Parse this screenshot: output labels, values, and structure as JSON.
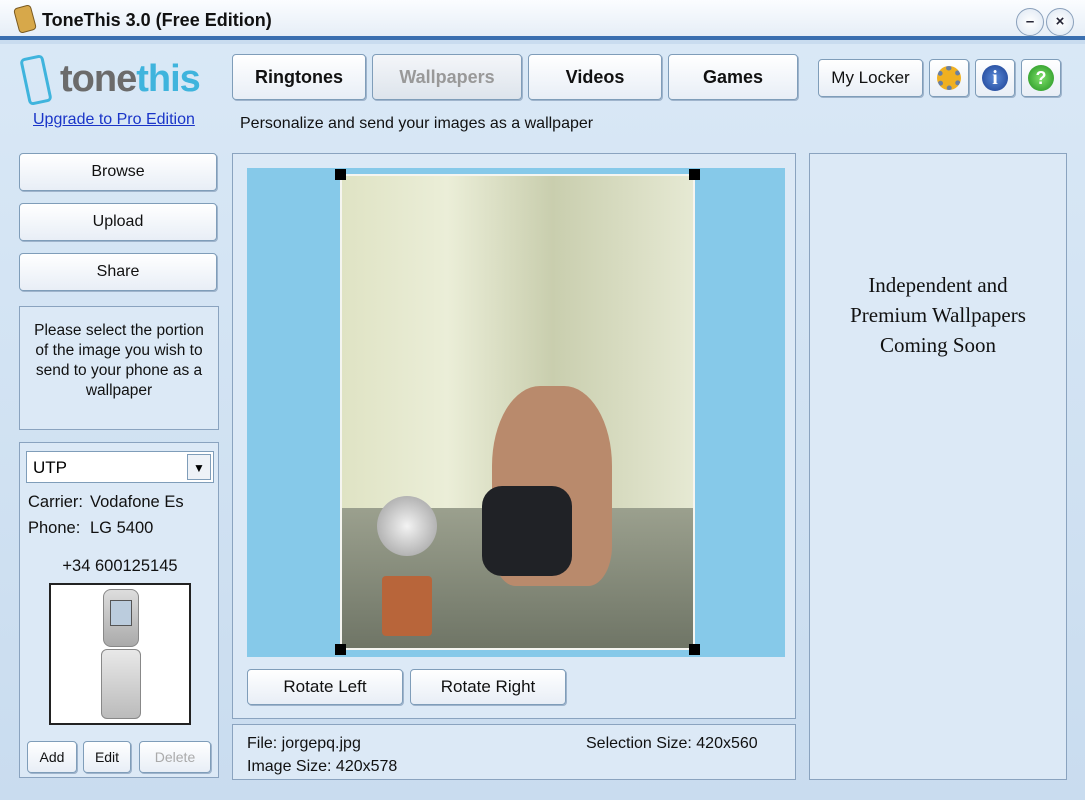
{
  "window": {
    "title": "ToneThis 3.0 (Free Edition)",
    "minimize": "–",
    "close": "×"
  },
  "logo": {
    "part1": "tone",
    "part2": "this"
  },
  "upgrade_link": "Upgrade to Pro Edition",
  "tabs": [
    {
      "label": "Ringtones",
      "selected": false
    },
    {
      "label": "Wallpapers",
      "selected": true
    },
    {
      "label": "Videos",
      "selected": false
    },
    {
      "label": "Games",
      "selected": false
    }
  ],
  "toolbar": {
    "my_locker": "My Locker",
    "settings_icon": "gear-wrench-icon",
    "info_icon": "info-icon",
    "help_icon": "help-icon"
  },
  "subtitle": "Personalize and send your images as a wallpaper",
  "sidebar": {
    "browse": "Browse",
    "upload": "Upload",
    "share": "Share",
    "instructions": "Please select the portion of the image you wish to send to your phone as a wallpaper"
  },
  "device": {
    "selected": "UTP",
    "carrier_label": "Carrier:",
    "carrier": "Vodafone Es",
    "phone_label": "Phone:",
    "phone": "LG 5400",
    "number": "+34 600125145",
    "add": "Add",
    "edit": "Edit",
    "delete": "Delete"
  },
  "editor": {
    "rotate_left": "Rotate Left",
    "rotate_right": "Rotate Right"
  },
  "fileinfo": {
    "file": "File: jorgepq.jpg",
    "image_size": "Image Size: 420x578",
    "selection_size": "Selection Size: 420x560"
  },
  "promo": {
    "line1": "Independent and",
    "line2": "Premium Wallpapers",
    "line3": "Coming Soon"
  },
  "colors": {
    "canvas_bg": "#86c9e9",
    "link": "#1a35c8",
    "accent": "#3fb4dd"
  }
}
